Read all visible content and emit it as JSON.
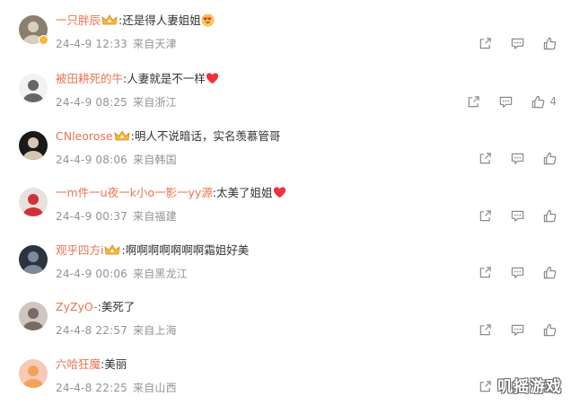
{
  "comments": [
    {
      "user": "一只胖辰",
      "vip": true,
      "badge": true,
      "text": ":还是得人妻姐姐",
      "emoji": "heart-eyes-emoji",
      "date": "24-4-9 12:33",
      "source": "来自天津",
      "likes": "",
      "avatar_colors": [
        "#8a7f6d",
        "#d9cfbf"
      ]
    },
    {
      "user": "被田耕死的牛",
      "vip": false,
      "badge": false,
      "text": ":人妻就是不一样",
      "emoji": "red-heart-emoji",
      "date": "24-4-9 08:25",
      "source": "来自浙江",
      "likes": "4",
      "avatar_colors": [
        "#f2f2f2",
        "#666666"
      ]
    },
    {
      "user": "CNleorose",
      "vip": true,
      "badge": false,
      "text": ":明人不说暗话，实名羡慕管哥",
      "emoji": "",
      "date": "24-4-9 08:06",
      "source": "来自韩国",
      "likes": "",
      "avatar_colors": [
        "#1a1a1a",
        "#d8c7b0"
      ]
    },
    {
      "user": "一m件一u夜一k小o一影一yy源",
      "vip": false,
      "badge": false,
      "text": ":太美了姐姐",
      "emoji": "red-heart-emoji",
      "date": "24-4-9 00:37",
      "source": "来自福建",
      "likes": "",
      "avatar_colors": [
        "#e9e1dc",
        "#d0313a"
      ]
    },
    {
      "user": "观乎四方i",
      "vip": true,
      "badge": false,
      "text": ":啊啊啊啊啊啊啊霜姐好美",
      "emoji": "",
      "date": "24-4-9 00:06",
      "source": "来自黑龙江",
      "likes": "",
      "avatar_colors": [
        "#2c3340",
        "#7c8a99"
      ]
    },
    {
      "user": "ZyZyO-",
      "vip": false,
      "badge": false,
      "text": ":美死了",
      "emoji": "",
      "date": "24-4-8 22:57",
      "source": "来自上海",
      "likes": "",
      "avatar_colors": [
        "#cfc6c2",
        "#7a6a66"
      ]
    },
    {
      "user": "六哈狂魔",
      "vip": false,
      "badge": false,
      "text": ":美丽",
      "emoji": "",
      "date": "24-4-8 22:25",
      "source": "来自山西",
      "likes": "",
      "avatar_colors": [
        "#f7c9b6",
        "#f4a259"
      ]
    }
  ],
  "watermark": "叽摇游戏",
  "colors": {
    "username": "#eb7350",
    "meta": "#939393",
    "heart": "#f0313c",
    "icon": "#8a8a8a"
  },
  "action_icons": [
    "share-icon",
    "comment-icon",
    "like-icon"
  ]
}
